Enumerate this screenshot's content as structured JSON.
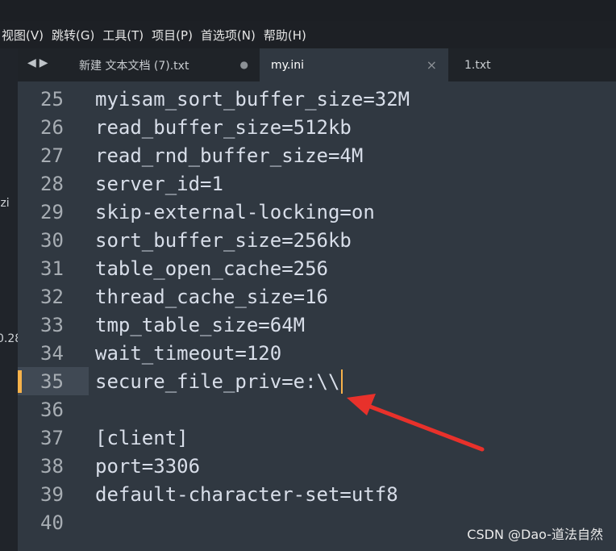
{
  "menu": {
    "items": [
      "视图(V)",
      "跳转(G)",
      "工具(T)",
      "项目(P)",
      "首选项(N)",
      "帮助(H)"
    ]
  },
  "sidebar": {
    "fragments": [
      ".zi",
      "0.28"
    ]
  },
  "tabs": [
    {
      "label": "新建 文本文档 (7).txt",
      "mark": "●"
    },
    {
      "label": "my.ini",
      "mark": "×"
    },
    {
      "label": "1.txt",
      "mark": ""
    }
  ],
  "editor": {
    "lines": [
      {
        "num": "25",
        "text": "myisam_sort_buffer_size=32M"
      },
      {
        "num": "26",
        "text": "read_buffer_size=512kb"
      },
      {
        "num": "27",
        "text": "read_rnd_buffer_size=4M"
      },
      {
        "num": "28",
        "text": "server_id=1"
      },
      {
        "num": "29",
        "text": "skip-external-locking=on"
      },
      {
        "num": "30",
        "text": "sort_buffer_size=256kb"
      },
      {
        "num": "31",
        "text": "table_open_cache=256"
      },
      {
        "num": "32",
        "text": "thread_cache_size=16"
      },
      {
        "num": "33",
        "text": "tmp_table_size=64M"
      },
      {
        "num": "34",
        "text": "wait_timeout=120"
      },
      {
        "num": "35",
        "text": "secure_file_priv=e:\\\\"
      },
      {
        "num": "36",
        "text": ""
      },
      {
        "num": "37",
        "text": "[client]"
      },
      {
        "num": "38",
        "text": "port=3306"
      },
      {
        "num": "39",
        "text": "default-character-set=utf8"
      },
      {
        "num": "40",
        "text": ""
      }
    ]
  },
  "watermark": "CSDN @Dao-道法自然",
  "colors": {
    "background": "#303841",
    "accent": "#f7b24a",
    "arrow": "#e8312b"
  }
}
